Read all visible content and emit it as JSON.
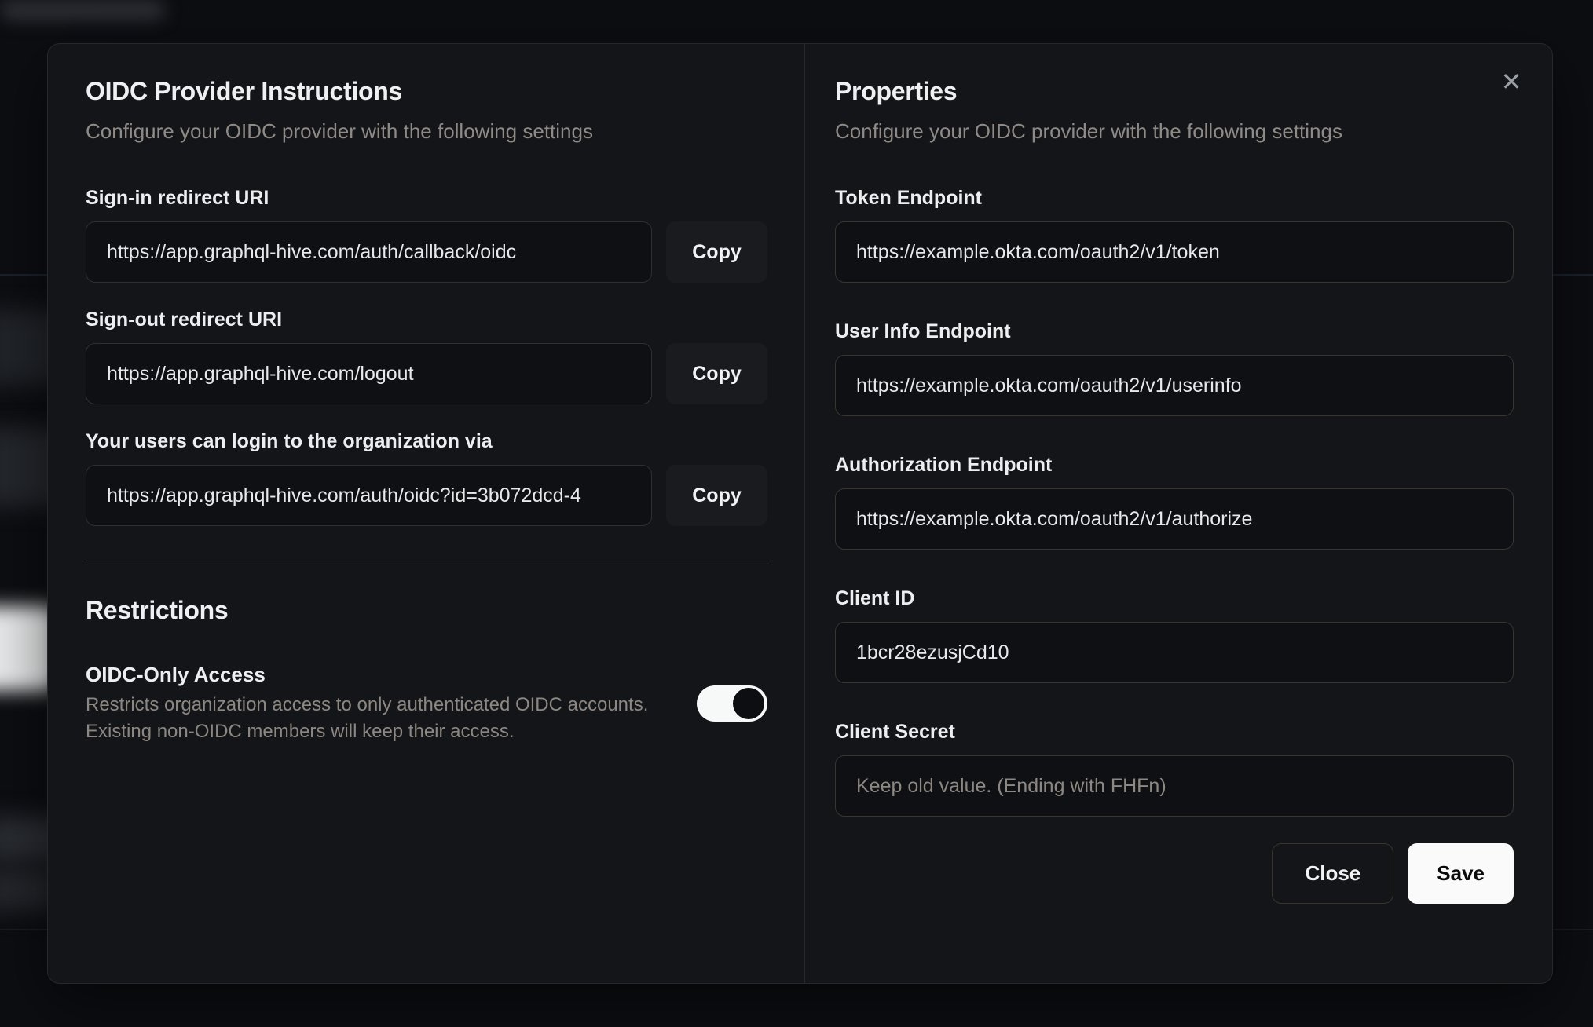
{
  "modal": {
    "close_icon": "✕",
    "left": {
      "title": "OIDC Provider Instructions",
      "subtitle": "Configure your OIDC provider with the following settings",
      "fields": [
        {
          "label": "Sign-in redirect URI",
          "value": "https://app.graphql-hive.com/auth/callback/oidc",
          "copy_label": "Copy"
        },
        {
          "label": "Sign-out redirect URI",
          "value": "https://app.graphql-hive.com/logout",
          "copy_label": "Copy"
        },
        {
          "label": "Your users can login to the organization via",
          "value": "https://app.graphql-hive.com/auth/oidc?id=3b072dcd-4",
          "copy_label": "Copy"
        }
      ],
      "restrictions": {
        "title": "Restrictions",
        "toggle_label": "OIDC-Only Access",
        "description": "Restricts organization access to only authenticated OIDC accounts. Existing non-OIDC members will keep their access.",
        "toggle_state": "on"
      }
    },
    "right": {
      "title": "Properties",
      "subtitle": "Configure your OIDC provider with the following settings",
      "fields": [
        {
          "label": "Token Endpoint",
          "value": "https://example.okta.com/oauth2/v1/token"
        },
        {
          "label": "User Info Endpoint",
          "value": "https://example.okta.com/oauth2/v1/userinfo"
        },
        {
          "label": "Authorization Endpoint",
          "value": "https://example.okta.com/oauth2/v1/authorize"
        },
        {
          "label": "Client ID",
          "value": "1bcr28ezusjCd10"
        },
        {
          "label": "Client Secret",
          "value": "",
          "placeholder": "Keep old value. (Ending with FHFn)"
        }
      ],
      "buttons": {
        "close": "Close",
        "save": "Save"
      }
    }
  },
  "colors": {
    "page_bg": "#0d0e12",
    "modal_bg": "#141519",
    "input_bg": "#0e1013",
    "save_button_bg": "#fafafa",
    "toggle_on_track": "#f7f8f8",
    "toggle_thumb": "#0c0e12",
    "muted_text": "#8f8a85"
  }
}
